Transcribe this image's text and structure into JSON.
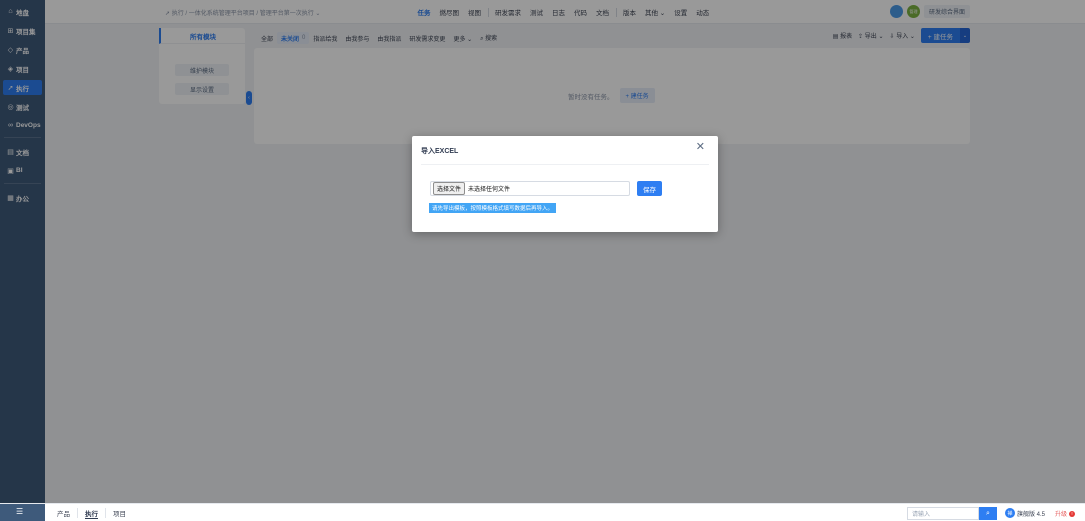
{
  "sidebar": {
    "items": [
      {
        "label": "地盘",
        "icon": "⌂"
      },
      {
        "label": "项目集",
        "icon": "⊞"
      },
      {
        "label": "产品",
        "icon": "◇"
      },
      {
        "label": "项目",
        "icon": "◈"
      },
      {
        "label": "执行",
        "icon": "➚"
      },
      {
        "label": "测试",
        "icon": "◎"
      },
      {
        "label": "DevOps",
        "icon": "∞"
      },
      {
        "label": "文档",
        "icon": "▤"
      },
      {
        "label": "BI",
        "icon": "▣"
      },
      {
        "label": "办公",
        "icon": "▦"
      }
    ],
    "menu_toggle": "☰"
  },
  "header": {
    "breadcrumb": "➚ 执行  /  一体化系统管理平台项目 / 管理平台第一次执行 ⌄",
    "nav": [
      "任务",
      "燃尽图",
      "视图",
      "研发需求",
      "测试",
      "日志",
      "代码",
      "文档",
      "版本",
      "其他 ⌄",
      "设置",
      "动态"
    ],
    "user_badge": "管理",
    "workbench_button": "研发综合界面"
  },
  "filters": {
    "items": [
      "全部",
      "未关闭",
      "指派给我",
      "由我参与",
      "由我指派",
      "研发需求变更",
      "更多 ⌄",
      "⌕ 搜索"
    ],
    "unclosed_count": "0"
  },
  "actions": {
    "report": "▤ 报表",
    "export": "⇪ 导出 ⌄",
    "import": "⇩ 导入 ⌄",
    "create_task": "+ 建任务",
    "caret": "⌄"
  },
  "module": {
    "title": "所有模块",
    "maintain": "维护模块",
    "display_settings": "显示设置",
    "collapse": "‹"
  },
  "list": {
    "empty_text": "暂时没有任务。",
    "create_button": "+ 建任务"
  },
  "modal": {
    "title": "导入EXCEL",
    "close": "✕",
    "choose_file": "选择文件",
    "no_file": "未选择任何文件",
    "save": "保存",
    "tip": "请先导出模板，按照模板格式填写数据后再导入。"
  },
  "footer": {
    "tabs": [
      "产品",
      "执行",
      "项目"
    ],
    "search_placeholder": "请输入",
    "search_icon": "⌕",
    "logo": "禅",
    "version": "旗舰版 4.5",
    "upgrade": "升级",
    "upgrade_badge": "!"
  }
}
